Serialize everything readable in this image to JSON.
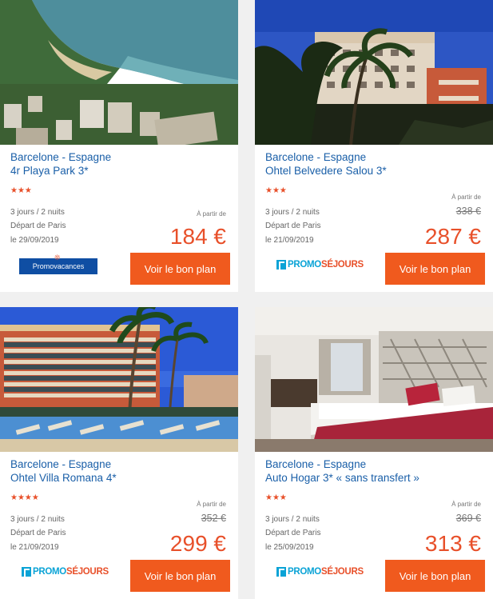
{
  "colors": {
    "accent": "#f05a1e",
    "link": "#1a5fa8",
    "star": "#e8502a"
  },
  "cards": [
    {
      "destination": "Barcelone - Espagne",
      "hotel": "4r Playa Park 3*",
      "stars": "★★★",
      "duration": "3 jours / 2 nuits",
      "departure": "Départ de Paris",
      "date": "le 29/09/2019",
      "from_label": "À partir de",
      "old_price": "",
      "price": "184 €",
      "button": "Voir le bon plan",
      "provider": "Promovacances",
      "provider_dots": "❊"
    },
    {
      "destination": "Barcelone - Espagne",
      "hotel": "Ohtel Belvedere Salou 3*",
      "stars": "★★★",
      "duration": "3 jours / 2 nuits",
      "departure": "Départ de Paris",
      "date": "le 21/09/2019",
      "from_label": "À partir de",
      "old_price": "338 €",
      "price": "287 €",
      "button": "Voir le bon plan",
      "provider_a": "PROMO",
      "provider_b": "SÉJOURS"
    },
    {
      "destination": "Barcelone - Espagne",
      "hotel": "Ohtel Villa Romana 4*",
      "stars": "★★★★",
      "duration": "3 jours / 2 nuits",
      "departure": "Départ de Paris",
      "date": "le 21/09/2019",
      "from_label": "À partir de",
      "old_price": "352 €",
      "price": "299 €",
      "button": "Voir le bon plan",
      "provider_a": "PROMO",
      "provider_b": "SÉJOURS"
    },
    {
      "destination": "Barcelone - Espagne",
      "hotel": "Auto Hogar 3* « sans transfert »",
      "stars": "★★★",
      "duration": "3 jours / 2 nuits",
      "departure": "Départ de Paris",
      "date": "le 25/09/2019",
      "from_label": "À partir de",
      "old_price": "369 €",
      "price": "313 €",
      "button": "Voir le bon plan",
      "provider_a": "PROMO",
      "provider_b": "SÉJOURS"
    }
  ]
}
